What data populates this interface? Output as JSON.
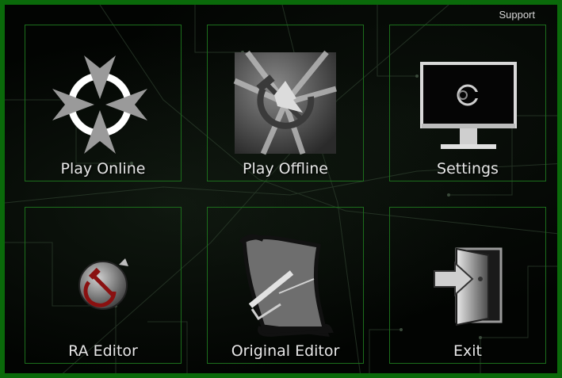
{
  "header": {
    "support_label": "Support"
  },
  "tiles": [
    {
      "label": "Play Online",
      "icon": "online-crosshair-icon"
    },
    {
      "label": "Play Offline",
      "icon": "hammer-sickle-icon"
    },
    {
      "label": "Settings",
      "icon": "monitor-icon"
    },
    {
      "label": "RA Editor",
      "icon": "ra-editor-emblem-icon"
    },
    {
      "label": "Original Editor",
      "icon": "scroll-icon"
    },
    {
      "label": "Exit",
      "icon": "exit-door-icon"
    }
  ],
  "colors": {
    "border": "#0a6a0a",
    "tile_border": "#1c6e1c",
    "text": "#e6e6e6",
    "background": "#020402"
  }
}
